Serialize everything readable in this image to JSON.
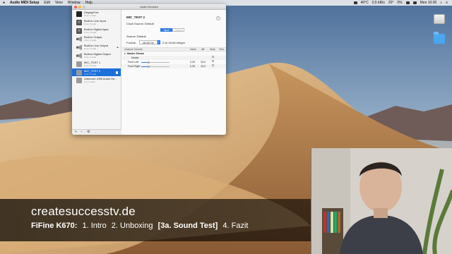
{
  "menubar": {
    "apple": "",
    "items": [
      "Audio MIDI Setup",
      "Edit",
      "View",
      "Window",
      "Help"
    ],
    "status": {
      "temp": "40°C",
      "net": "0,5 kB/s",
      "weather": "20°",
      "mem": "0%",
      "clock": "Mon 10:00"
    }
  },
  "window": {
    "title": "Audio Devices",
    "devices": [
      {
        "name": "DisplayPort",
        "sub": "0 ins / 2 outs",
        "icon": "displayport-icon"
      },
      {
        "name": "Built-in Line Input",
        "sub": "2 ins / 0 outs",
        "icon": "microphone-icon"
      },
      {
        "name": "Built-in Digital Input",
        "sub": "2 ins / 0 outs",
        "icon": "microphone-icon"
      },
      {
        "name": "Built-in Output",
        "sub": "0 ins / 2 outs",
        "icon": "speaker-icon"
      },
      {
        "name": "Built-in Line Output",
        "sub": "0 ins / 2 outs",
        "icon": "speaker-icon"
      },
      {
        "name": "Built-in Digital Output",
        "sub": "0 ins / 2 outs",
        "icon": "speaker-icon"
      },
      {
        "name": "MIC_TEST 1",
        "sub": "2 ins / 0 outs",
        "icon": "usb-icon"
      },
      {
        "name": "MIC_TEST 2",
        "sub": "2 ins / 0 outs",
        "icon": "usb-icon"
      },
      {
        "name": "Unknown USB Audio De...",
        "sub": "1 in / 0 outs",
        "icon": "usb-icon"
      }
    ],
    "selected_index": 7,
    "footer": {
      "add": "+",
      "remove": "−",
      "action": "⚙"
    },
    "detail": {
      "device_title": "MIC_TEST 2",
      "help": "?",
      "clock_label": "Clock Source:",
      "clock_value": "Default",
      "tabs": [
        "Input",
        "Output"
      ],
      "active_tab": "Input",
      "source_label": "Source:",
      "source_value": "Default",
      "format_label": "Format:",
      "format_value": "48.000 Hz",
      "format_desc": "2 ch 16-bit Integer",
      "table_headers": [
        "Channel Volume",
        "Value",
        "dB",
        "Mute",
        "Thru"
      ],
      "group": "Master Stream",
      "channels": [
        {
          "name": "Master",
          "value": "",
          "db": "",
          "level": 0
        },
        {
          "name": "Front Left",
          "value": "0,25",
          "db": "15,0",
          "level": 0.25
        },
        {
          "name": "Front Right",
          "value": "0,25",
          "db": "15,0",
          "level": 0.25
        }
      ]
    }
  },
  "overlay": {
    "site": "createsuccesstv.de",
    "lead": "FiFine K670:",
    "chapters": [
      "1. Intro",
      "2. Unboxing",
      "[3a. Sound Test]",
      "4. Fazit"
    ],
    "current_index": 2
  }
}
